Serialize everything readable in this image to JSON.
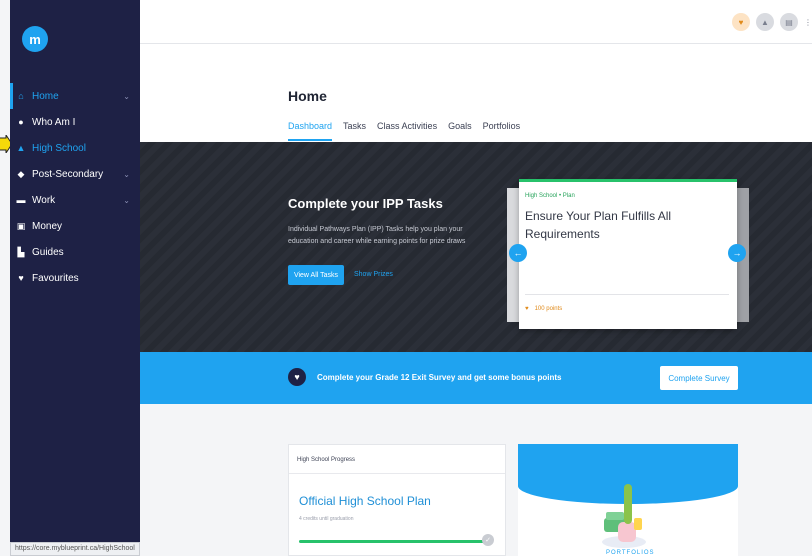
{
  "sidebar": {
    "logo": "m",
    "items": [
      {
        "label": "Home",
        "icon": "home-icon",
        "glyph": "⌂",
        "chevron": "⌄"
      },
      {
        "label": "Who Am I",
        "icon": "user-circle-icon",
        "glyph": "●",
        "chevron": ""
      },
      {
        "label": "High School",
        "icon": "school-icon",
        "glyph": "▲",
        "chevron": ""
      },
      {
        "label": "Post-Secondary",
        "icon": "graduation-cap-icon",
        "glyph": "◆",
        "chevron": "⌄"
      },
      {
        "label": "Work",
        "icon": "briefcase-icon",
        "glyph": "▬",
        "chevron": "⌄"
      },
      {
        "label": "Money",
        "icon": "money-icon",
        "glyph": "▣",
        "chevron": ""
      },
      {
        "label": "Guides",
        "icon": "book-icon",
        "glyph": "▙",
        "chevron": ""
      },
      {
        "label": "Favourites",
        "icon": "heart-icon",
        "glyph": "♥",
        "chevron": ""
      }
    ],
    "status_url": "https://core.myblueprint.ca/HighSchool"
  },
  "page": {
    "title": "Home",
    "tabs": [
      "Dashboard",
      "Tasks",
      "Class Activities",
      "Goals",
      "Portfolios"
    ]
  },
  "hero": {
    "title": "Complete your IPP Tasks",
    "description": "Individual Pathways Plan (IPP) Tasks help you plan your education and career while earning points for prize draws",
    "primary_button": "View All Tasks",
    "secondary_link": "Show Prizes",
    "card": {
      "category": "High School • Plan",
      "title": "Ensure Your Plan Fulfills All Requirements",
      "points": "100 points"
    }
  },
  "banner": {
    "text": "Complete your Grade 12 Exit Survey and get some bonus points",
    "button": "Complete Survey"
  },
  "progress_card": {
    "header": "High School Progress",
    "title": "Official High School Plan",
    "subtitle": "4 credits until graduation",
    "progress": 0.95
  },
  "promo_card": {
    "label": "PORTFOLIOS"
  },
  "colors": {
    "accent": "#1fa3f0",
    "sidebar": "#1e2145",
    "success": "#27c26b",
    "points": "#e08a1a"
  }
}
